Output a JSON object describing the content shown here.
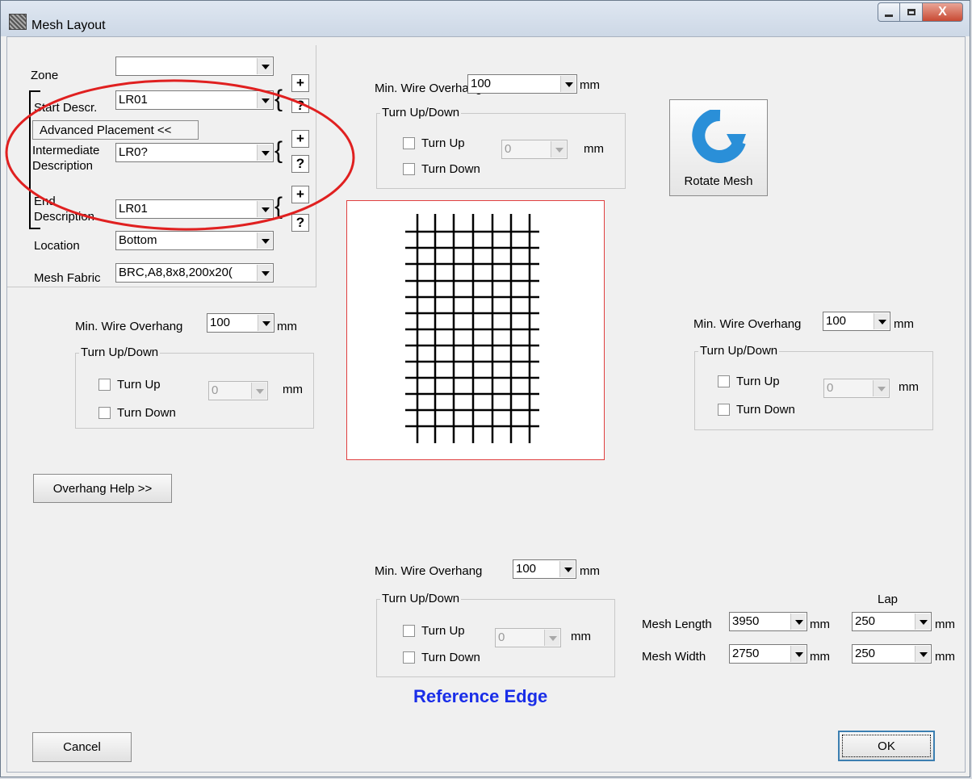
{
  "window": {
    "title": "Mesh Layout",
    "close_label": "X"
  },
  "top_left": {
    "zone_label": "Zone",
    "zone_value": "",
    "start_label": "Start Descr.",
    "start_value": "LR01",
    "advanced_button": "Advanced Placement <<",
    "intermediate_label_1": "Intermediate",
    "intermediate_label_2": "Description",
    "intermediate_value": "LR0?",
    "end_label_1": "End",
    "end_label_2": "Description",
    "end_value": "LR01",
    "location_label": "Location",
    "location_value": "Bottom",
    "fabric_label": "Mesh Fabric",
    "fabric_value": "BRC,A8,8x8,200x20(",
    "plus": "+",
    "question": "?",
    "brace": "{"
  },
  "top_overhang": {
    "label": "Min. Wire Overhang",
    "value": "100",
    "unit": "mm",
    "group_title": "Turn Up/Down",
    "turn_up": "Turn Up",
    "turn_down": "Turn Down",
    "turn_value": "0",
    "turn_unit": "mm"
  },
  "left_overhang": {
    "label": "Min. Wire Overhang",
    "value": "100",
    "unit": "mm",
    "group_title": "Turn Up/Down",
    "turn_up": "Turn Up",
    "turn_down": "Turn Down",
    "turn_value": "0",
    "turn_unit": "mm"
  },
  "right_overhang": {
    "label": "Min. Wire Overhang",
    "value": "100",
    "unit": "mm",
    "group_title": "Turn Up/Down",
    "turn_up": "Turn Up",
    "turn_down": "Turn Down",
    "turn_value": "0",
    "turn_unit": "mm"
  },
  "bottom_overhang": {
    "label": "Min. Wire Overhang",
    "value": "100",
    "unit": "mm",
    "group_title": "Turn Up/Down",
    "turn_up": "Turn Up",
    "turn_down": "Turn Down",
    "turn_value": "0",
    "turn_unit": "mm"
  },
  "rotate_label": "Rotate Mesh",
  "overhang_help": "Overhang Help >>",
  "reference_edge": "Reference Edge",
  "mesh_dims": {
    "lap_label": "Lap",
    "length_label": "Mesh Length",
    "length_value": "3950",
    "length_lap": "250",
    "width_label": "Mesh Width",
    "width_value": "2750",
    "width_lap": "250",
    "unit": "mm"
  },
  "cancel_label": "Cancel",
  "ok_label": "OK",
  "colors": {
    "annotation_ellipse": "#e02020",
    "reference_edge": "#1a2ee8",
    "rotate_icon": "#2a8fd8"
  }
}
